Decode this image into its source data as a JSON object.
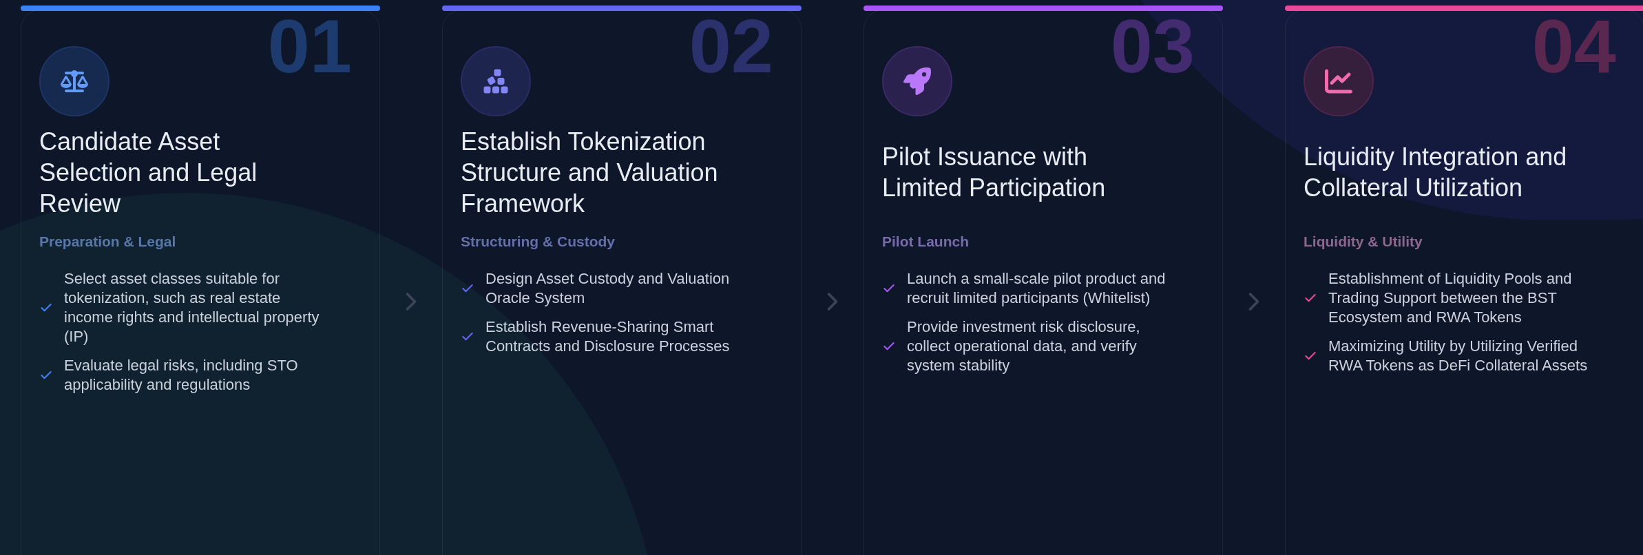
{
  "steps": [
    {
      "number": "01",
      "kind": "scale",
      "color": "#3b82f6",
      "title": "Candidate Asset Selection and Legal Review",
      "subtitle": "Preparation & Legal",
      "items": [
        "Select asset classes suitable for tokenization, such as real estate income rights and intellectual property (IP)",
        "Evaluate legal risks, including STO applicability and regulations"
      ]
    },
    {
      "number": "02",
      "kind": "blocks",
      "color": "#6366f1",
      "title": "Establish Tokenization Structure and Valuation Framework",
      "subtitle": "Structuring & Custody",
      "items": [
        "Design Asset Custody and Valuation Oracle System",
        "Establish Revenue-Sharing Smart Contracts and Disclosure Processes"
      ]
    },
    {
      "number": "03",
      "kind": "rocket",
      "color": "#a855f7",
      "title": "Pilot Issuance with Limited Participation",
      "subtitle": "Pilot Launch",
      "items": [
        "Launch a small-scale pilot product and recruit limited participants (Whitelist)",
        "Provide investment risk disclosure, collect operational data, and verify system stability"
      ]
    },
    {
      "number": "04",
      "kind": "chart",
      "color": "#ec4899",
      "title": "Liquidity Integration and Collateral Utilization",
      "subtitle": "Liquidity & Utility",
      "items": [
        "Establishment of Liquidity Pools and Trading Support between the BST Ecosystem and RWA Tokens",
        "Maximizing Utility by Utilizing Verified RWA Tokens as DeFi Collateral Assets"
      ]
    }
  ]
}
